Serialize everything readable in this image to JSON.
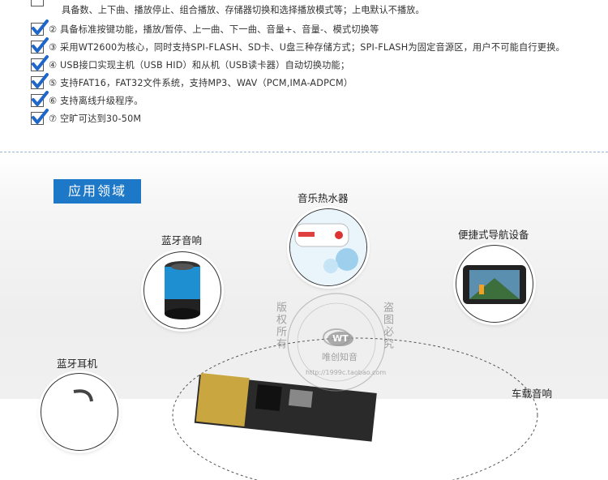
{
  "features": {
    "continuation": "具备数、上下曲、播放停止、组合播放、存储器切换和选择播放模式等；上电默认不播放。",
    "items": [
      {
        "text": "② 具备标准按键功能，播放/暂停、上一曲、下一曲、音量+、音量-、模式切换等"
      },
      {
        "text": "③ 采用WT2600为核心，同时支持SPI-FLASH、SD卡、U盘三种存储方式；SPI-FLASH为固定音源区，用户不可能自行更换。"
      },
      {
        "text": "④ USB接口实现主机（USB HID）和从机（USB读卡器）自动切换功能；"
      },
      {
        "text": "⑤ 支持FAT16，FAT32文件系统，支持MP3、WAV（PCM,IMA-ADPCM）"
      },
      {
        "text": "⑥ 支持离线升级程序。"
      },
      {
        "text": "⑦ 空旷可达到30-50M"
      }
    ]
  },
  "applications": {
    "title": "应用领域",
    "items": {
      "water_heater": "音乐热水器",
      "bt_speaker": "蓝牙音响",
      "navigator": "便捷式导航设备",
      "bt_earphone": "蓝牙耳机",
      "car_audio": "车载音响"
    }
  },
  "watermark": {
    "arc_left": "版权所有",
    "arc_right": "盗图必究",
    "logo": "WT",
    "brand": "唯创知音",
    "url": "http://1999c.taobao.com"
  },
  "colors": {
    "accent": "#1e78c8",
    "check": "#1f66c9",
    "divider": "#9bb6d8"
  }
}
